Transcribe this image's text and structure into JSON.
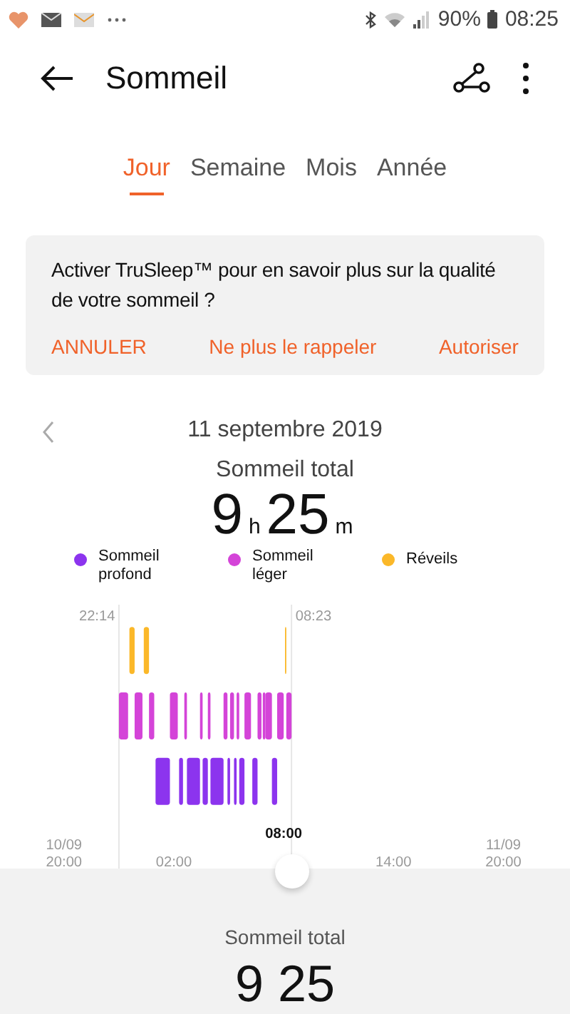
{
  "status_bar": {
    "battery": "90%",
    "time": "08:25"
  },
  "header": {
    "title": "Sommeil"
  },
  "tabs": [
    {
      "label": "Jour",
      "selected": true
    },
    {
      "label": "Semaine",
      "selected": false
    },
    {
      "label": "Mois",
      "selected": false
    },
    {
      "label": "Année",
      "selected": false
    }
  ],
  "prompt": {
    "text": "Activer TruSleep™ pour en savoir plus sur la qualité de votre sommeil ?",
    "actions": [
      "ANNULER",
      "Ne plus le rappeler",
      "Autoriser"
    ]
  },
  "date_nav": {
    "date": "11 septembre 2019"
  },
  "summary": {
    "label": "Sommeil total",
    "hours": "9",
    "hours_unit": "h",
    "minutes": "25",
    "minutes_unit": "m"
  },
  "legend": [
    {
      "label": "Sommeil profond",
      "color": "#8c34ee"
    },
    {
      "label": "Sommeil léger",
      "color": "#d444d8"
    },
    {
      "label": "Réveils",
      "color": "#fbb829"
    }
  ],
  "chart": {
    "start": "22:14",
    "end": "08:23",
    "marker": "08:00",
    "axis": [
      {
        "date": "10/09",
        "time": "20:00"
      },
      {
        "time": "02:00"
      },
      {
        "time": "14:00"
      },
      {
        "date": "11/09",
        "time": "20:00"
      }
    ]
  },
  "bottom": {
    "label": "Sommeil total",
    "value": "9 25"
  }
}
